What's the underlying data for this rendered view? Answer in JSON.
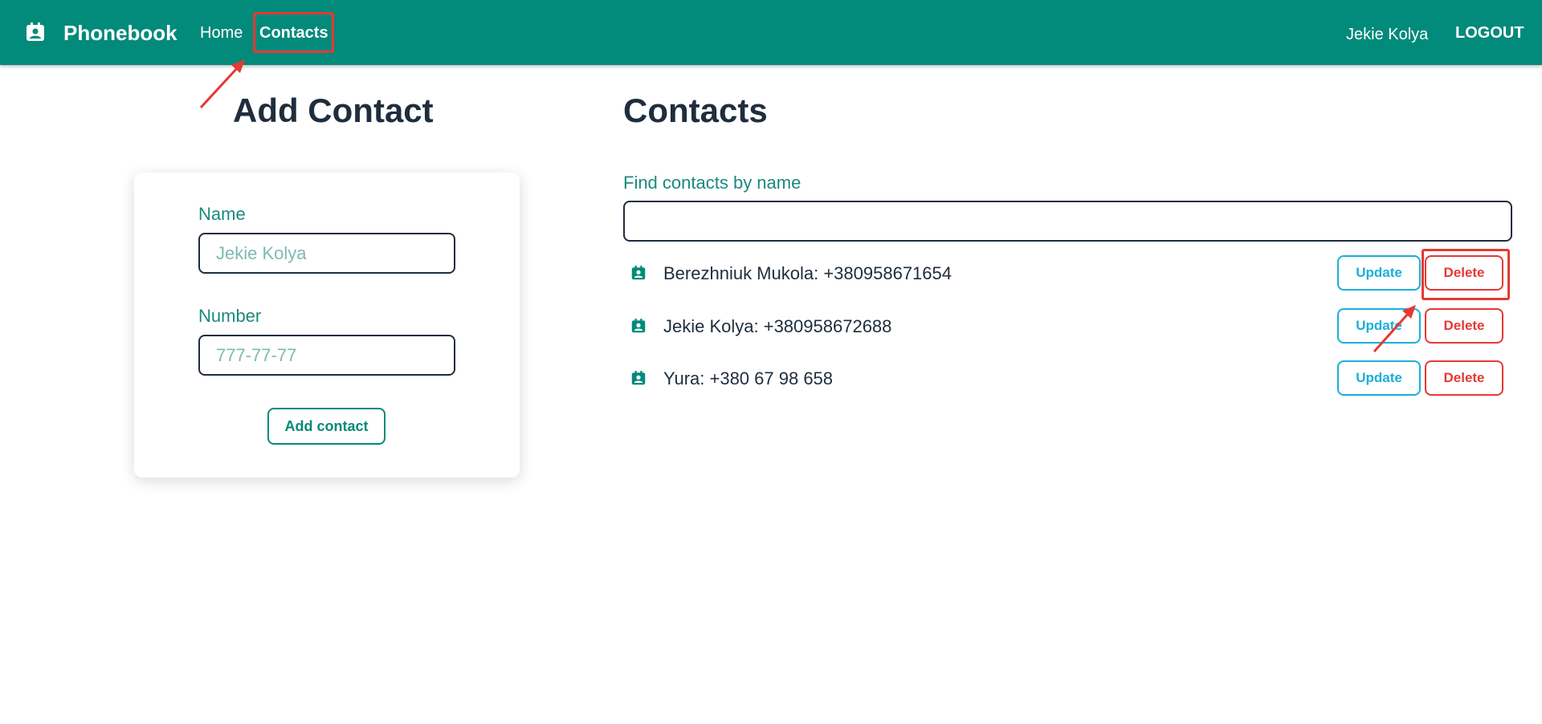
{
  "header": {
    "brand": "Phonebook",
    "brand_icon": "contact-badge-icon",
    "nav": {
      "home": "Home",
      "contacts": "Contacts"
    },
    "user_name": "Jekie Kolya",
    "logout": "LOGOUT"
  },
  "add_contact": {
    "title": "Add Contact",
    "name_label": "Name",
    "name_placeholder": "Jekie Kolya",
    "number_label": "Number",
    "number_placeholder": "777-77-77",
    "submit": "Add contact"
  },
  "contacts": {
    "title": "Contacts",
    "filter_label": "Find contacts by name",
    "filter_value": "",
    "items": [
      {
        "text": "Berezhniuk Mukola: +380958671654",
        "update": "Update",
        "delete": "Delete"
      },
      {
        "text": "Jekie Kolya: +380958672688",
        "update": "Update",
        "delete": "Delete"
      },
      {
        "text": "Yura: +380 67 98 658",
        "update": "Update",
        "delete": "Delete"
      }
    ]
  },
  "colors": {
    "appbar": "#028a7a",
    "accent": "#1a8a7c",
    "update": "#1ab0d8",
    "delete": "#e53935",
    "annotation": "#e53935"
  }
}
